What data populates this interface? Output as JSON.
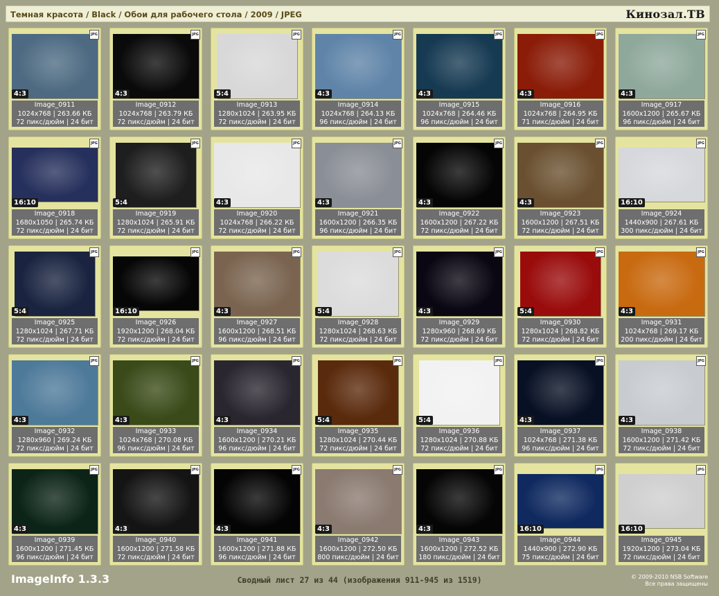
{
  "header": {
    "breadcrumb": "Темная красота / Black / Обои для рабочего стола / 2009 / JPEG",
    "brand": "Кинозал.ТВ"
  },
  "icons": {
    "file_type": "jpg-file-icon"
  },
  "file_badge": "JPG",
  "images": [
    {
      "name": "Image_0911",
      "dims": "1024x768 | 263.66 КБ",
      "meta": "72 пикс/дюйм | 24 бит",
      "ratio": "4:3",
      "bg": "#4d6a82"
    },
    {
      "name": "Image_0912",
      "dims": "1024x768 | 263.79 КБ",
      "meta": "72 пикс/дюйм | 24 бит",
      "ratio": "4:3",
      "bg": "#0a0a0a"
    },
    {
      "name": "Image_0913",
      "dims": "1280x1024 | 263.95 КБ",
      "meta": "72 пикс/дюйм | 24 бит",
      "ratio": "5:4",
      "bg": "#d8d8d8"
    },
    {
      "name": "Image_0914",
      "dims": "1024x768 | 264.13 КБ",
      "meta": "96 пикс/дюйм | 24 бит",
      "ratio": "4:3",
      "bg": "#5f84a8"
    },
    {
      "name": "Image_0915",
      "dims": "1024x768 | 264.46 КБ",
      "meta": "96 пикс/дюйм | 24 бит",
      "ratio": "4:3",
      "bg": "#163a52"
    },
    {
      "name": "Image_0916",
      "dims": "1024x768 | 264.95 КБ",
      "meta": "71 пикс/дюйм | 24 бит",
      "ratio": "4:3",
      "bg": "#8a1c08"
    },
    {
      "name": "Image_0917",
      "dims": "1600x1200 | 265.67 КБ",
      "meta": "96 пикс/дюйм | 24 бит",
      "ratio": "4:3",
      "bg": "#8fa89c"
    },
    {
      "name": "Image_0918",
      "dims": "1680x1050 | 265.74 КБ",
      "meta": "72 пикс/дюйм | 24 бит",
      "ratio": "16:10",
      "bg": "#26305c"
    },
    {
      "name": "Image_0919",
      "dims": "1280x1024 | 265.91 КБ",
      "meta": "72 пикс/дюйм | 24 бит",
      "ratio": "5:4",
      "bg": "#1e1e1e"
    },
    {
      "name": "Image_0920",
      "dims": "1024x768 | 266.22 КБ",
      "meta": "72 пикс/дюйм | 24 бит",
      "ratio": "4:3",
      "bg": "#e8e8e8"
    },
    {
      "name": "Image_0921",
      "dims": "1600x1200 | 266.35 КБ",
      "meta": "96 пикс/дюйм | 24 бит",
      "ratio": "4:3",
      "bg": "#8a8e96"
    },
    {
      "name": "Image_0922",
      "dims": "1600x1200 | 267.22 КБ",
      "meta": "72 пикс/дюйм | 24 бит",
      "ratio": "4:3",
      "bg": "#050505"
    },
    {
      "name": "Image_0923",
      "dims": "1600x1200 | 267.51 КБ",
      "meta": "72 пикс/дюйм | 24 бит",
      "ratio": "4:3",
      "bg": "#6a5030"
    },
    {
      "name": "Image_0924",
      "dims": "1440x900 | 267.61 КБ",
      "meta": "300 пикс/дюйм | 24 бит",
      "ratio": "16:10",
      "bg": "#d6d8dc"
    },
    {
      "name": "Image_0925",
      "dims": "1280x1024 | 267.71 КБ",
      "meta": "72 пикс/дюйм | 24 бит",
      "ratio": "5:4",
      "bg": "#1a2440"
    },
    {
      "name": "Image_0926",
      "dims": "1920x1200 | 268.04 КБ",
      "meta": "72 пикс/дюйм | 24 бит",
      "ratio": "16:10",
      "bg": "#060606"
    },
    {
      "name": "Image_0927",
      "dims": "1600x1200 | 268.51 КБ",
      "meta": "96 пикс/дюйм | 24 бит",
      "ratio": "4:3",
      "bg": "#7a6450"
    },
    {
      "name": "Image_0928",
      "dims": "1280x1024 | 268.63 КБ",
      "meta": "72 пикс/дюйм | 24 бит",
      "ratio": "5:4",
      "bg": "#dcdcdc"
    },
    {
      "name": "Image_0929",
      "dims": "1280x960 | 268.69 КБ",
      "meta": "72 пикс/дюйм | 24 бит",
      "ratio": "4:3",
      "bg": "#0a0612"
    },
    {
      "name": "Image_0930",
      "dims": "1280x1024 | 268.82 КБ",
      "meta": "72 пикс/дюйм | 24 бит",
      "ratio": "5:4",
      "bg": "#9a0c0c"
    },
    {
      "name": "Image_0931",
      "dims": "1024x768 | 269.17 КБ",
      "meta": "200 пикс/дюйм | 24 бит",
      "ratio": "4:3",
      "bg": "#c86a10"
    },
    {
      "name": "Image_0932",
      "dims": "1280x960 | 269.24 КБ",
      "meta": "72 пикс/дюйм | 24 бит",
      "ratio": "4:3",
      "bg": "#4e7a9a"
    },
    {
      "name": "Image_0933",
      "dims": "1024x768 | 270.08 КБ",
      "meta": "96 пикс/дюйм | 24 бит",
      "ratio": "4:3",
      "bg": "#3a4a18"
    },
    {
      "name": "Image_0934",
      "dims": "1600x1200 | 270.21 КБ",
      "meta": "96 пикс/дюйм | 24 бит",
      "ratio": "4:3",
      "bg": "#2a2630"
    },
    {
      "name": "Image_0935",
      "dims": "1280x1024 | 270.44 КБ",
      "meta": "72 пикс/дюйм | 24 бит",
      "ratio": "5:4",
      "bg": "#5a2a0c"
    },
    {
      "name": "Image_0936",
      "dims": "1280x1024 | 270.88 КБ",
      "meta": "72 пикс/дюйм | 24 бит",
      "ratio": "5:4",
      "bg": "#f2f2f2"
    },
    {
      "name": "Image_0937",
      "dims": "1024x768 | 271.38 КБ",
      "meta": "96 пикс/дюйм | 24 бит",
      "ratio": "4:3",
      "bg": "#081024"
    },
    {
      "name": "Image_0938",
      "dims": "1600x1200 | 271.42 КБ",
      "meta": "72 пикс/дюйм | 24 бит",
      "ratio": "4:3",
      "bg": "#c8ccd0"
    },
    {
      "name": "Image_0939",
      "dims": "1600x1200 | 271.45 КБ",
      "meta": "96 пикс/дюйм | 24 бит",
      "ratio": "4:3",
      "bg": "#0c2418"
    },
    {
      "name": "Image_0940",
      "dims": "1600x1200 | 271.58 КБ",
      "meta": "72 пикс/дюйм | 24 бит",
      "ratio": "4:3",
      "bg": "#141414"
    },
    {
      "name": "Image_0941",
      "dims": "1600x1200 | 271.88 КБ",
      "meta": "96 пикс/дюйм | 24 бит",
      "ratio": "4:3",
      "bg": "#040404"
    },
    {
      "name": "Image_0942",
      "dims": "1600x1200 | 272.50 КБ",
      "meta": "800 пикс/дюйм | 24 бит",
      "ratio": "4:3",
      "bg": "#8a7a70"
    },
    {
      "name": "Image_0943",
      "dims": "1600x1200 | 272.52 КБ",
      "meta": "180 пикс/дюйм | 24 бит",
      "ratio": "4:3",
      "bg": "#050505"
    },
    {
      "name": "Image_0944",
      "dims": "1440x900 | 272.90 КБ",
      "meta": "75 пикс/дюйм | 24 бит",
      "ratio": "16:10",
      "bg": "#102a60"
    },
    {
      "name": "Image_0945",
      "dims": "1920x1200 | 273.04 КБ",
      "meta": "72 пикс/дюйм | 24 бит",
      "ratio": "16:10",
      "bg": "#cfcfcf"
    }
  ],
  "footer": {
    "app_title": "ImageInfo 1.3.3",
    "summary": "Сводный лист 27 из 44 (изображения 911-945 из 1519)",
    "copyright": "© 2009-2010 NSB Software",
    "rights": "Все права защищены"
  }
}
